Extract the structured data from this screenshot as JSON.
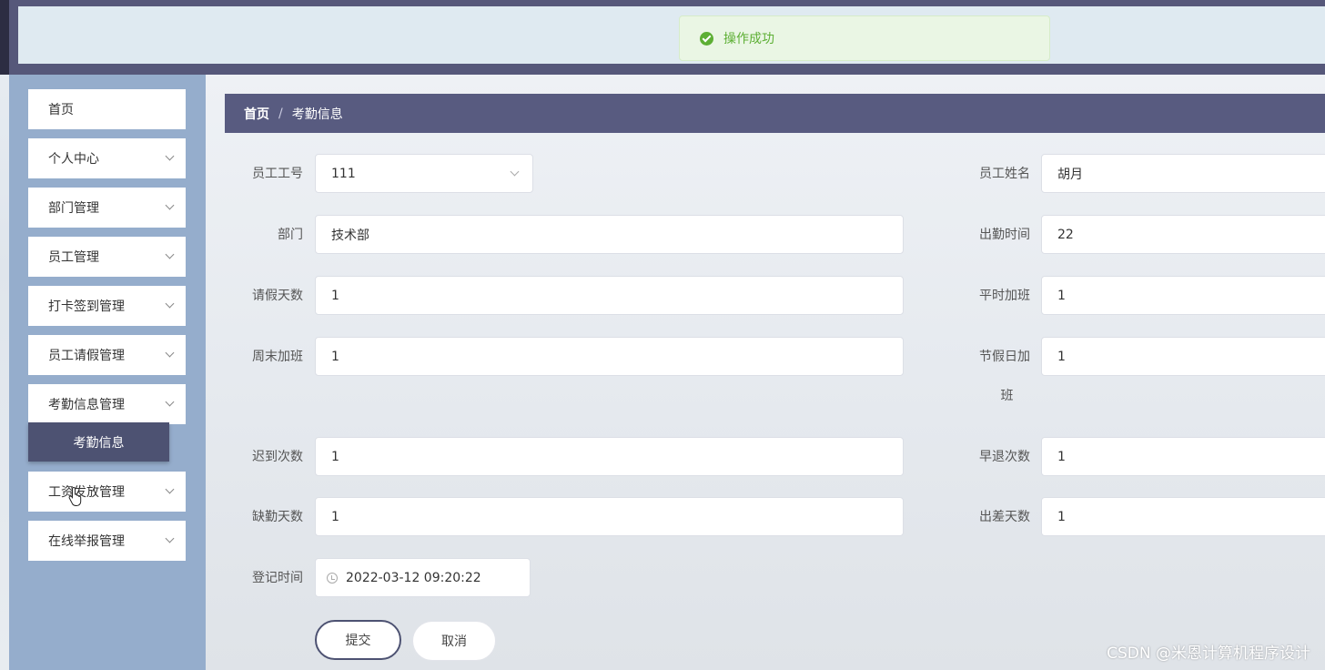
{
  "toast": {
    "message": "操作成功"
  },
  "sidebar": {
    "items": [
      {
        "label": "首页"
      },
      {
        "label": "个人中心"
      },
      {
        "label": "部门管理"
      },
      {
        "label": "员工管理"
      },
      {
        "label": "打卡签到管理"
      },
      {
        "label": "员工请假管理"
      },
      {
        "label": "考勤信息管理"
      },
      {
        "label": "工资发放管理"
      },
      {
        "label": "在线举报管理"
      }
    ],
    "active_submenu": "考勤信息"
  },
  "breadcrumb": {
    "home": "首页",
    "separator": "/",
    "current": "考勤信息"
  },
  "form": {
    "employee_id": {
      "label": "员工工号",
      "value": "111"
    },
    "employee_name": {
      "label": "员工姓名",
      "value": "胡月"
    },
    "department": {
      "label": "部门",
      "value": "技术部"
    },
    "attendance_time": {
      "label": "出勤时间",
      "value": "22"
    },
    "leave_days": {
      "label": "请假天数",
      "value": "1"
    },
    "weekday_overtime": {
      "label": "平时加班",
      "value": "1"
    },
    "weekend_overtime": {
      "label": "周末加班",
      "value": "1"
    },
    "holiday_overtime": {
      "label_line1": "节假日加",
      "label_line2": "班",
      "value": "1"
    },
    "late_count": {
      "label": "迟到次数",
      "value": "1"
    },
    "early_leave_count": {
      "label": "早退次数",
      "value": "1"
    },
    "absent_days": {
      "label": "缺勤天数",
      "value": "1"
    },
    "business_trip_days": {
      "label": "出差天数",
      "value": "1"
    },
    "register_time": {
      "label": "登记时间",
      "value": "2022-03-12 09:20:22"
    }
  },
  "buttons": {
    "submit": "提交",
    "cancel": "取消"
  },
  "watermark": "CSDN @米恩计算机程序设计"
}
